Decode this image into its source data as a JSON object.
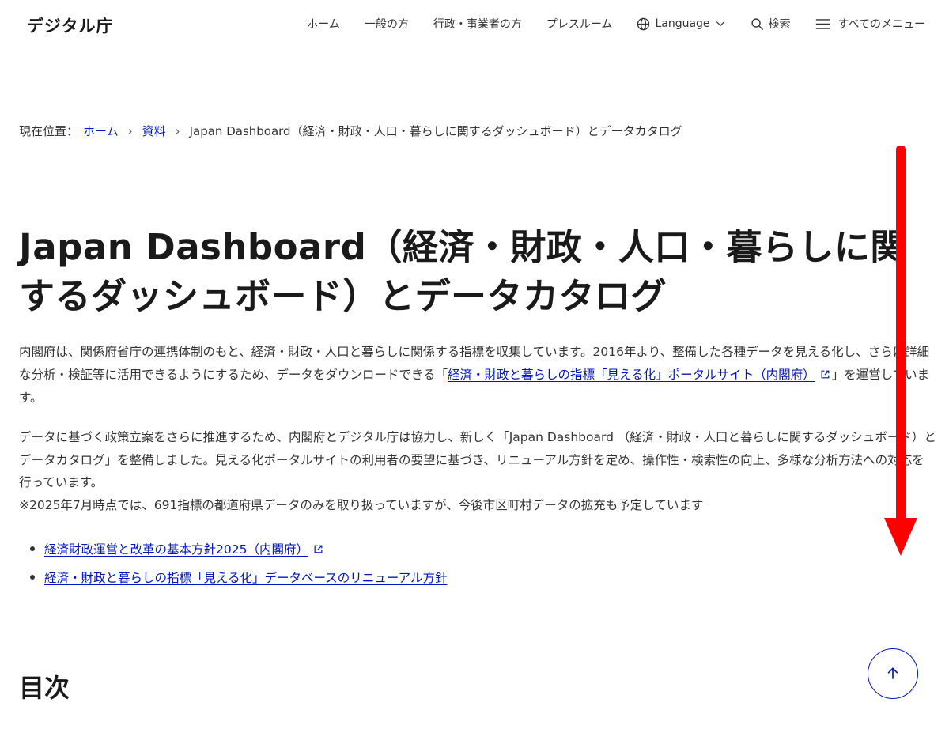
{
  "header": {
    "logo": "デジタル庁",
    "nav": [
      {
        "label": "ホーム"
      },
      {
        "label": "一般の方"
      },
      {
        "label": "行政・事業者の方"
      },
      {
        "label": "プレスルーム"
      },
      {
        "label": "Language"
      },
      {
        "label": "検索"
      },
      {
        "label": "すべてのメニュー"
      }
    ]
  },
  "breadcrumb": {
    "label": "現在位置：",
    "items": [
      {
        "label": "ホーム"
      },
      {
        "label": "資料"
      },
      {
        "label": "Japan Dashboard（経済・財政・人口・暮らしに関するダッシュボード）とデータカタログ"
      }
    ]
  },
  "title": "Japan Dashboard（経済・財政・人口・暮らしに関するダッシュボード）とデータカタログ",
  "paragraph1": {
    "before": "内閣府は、関係府省庁の連携体制のもと、経済・財政・人口と暮らしに関係する指標を収集しています。2016年より、整備した各種データを見える化し、さらに詳細な分析・検証等に活用できるようにするため、データをダウンロードできる「",
    "link": "経済・財政と暮らしの指標「見える化」ポータルサイト（内閣府）",
    "after": "」を運営しています。"
  },
  "paragraph2": {
    "line1": "データに基づく政策立案をさらに推進するため、内閣府とデジタル庁は協力し、新しく「Japan Dashboard （経済・財政・人口と暮らしに関するダッシュボード）とデータカタログ」を整備しました。見える化ポータルサイトの利用者の要望に基づき、リニューアル方針を定め、操作性・検索性の向上、多様な分析方法への対応を行っています。",
    "line2": "※2025年7月時点では、691指標の都道府県データのみを取り扱っていますが、今後市区町村データの拡充も予定しています"
  },
  "links": [
    {
      "label": "経済財政運営と改革の基本方針2025（内閣府）",
      "external": true
    },
    {
      "label": "経済・財政と暮らしの指標「見える化」データベースのリニューアル方針",
      "external": false
    }
  ],
  "toc": {
    "heading": "目次"
  },
  "colors": {
    "link": "#0017c1",
    "arrow": "#ff0000",
    "text": "#333333"
  }
}
